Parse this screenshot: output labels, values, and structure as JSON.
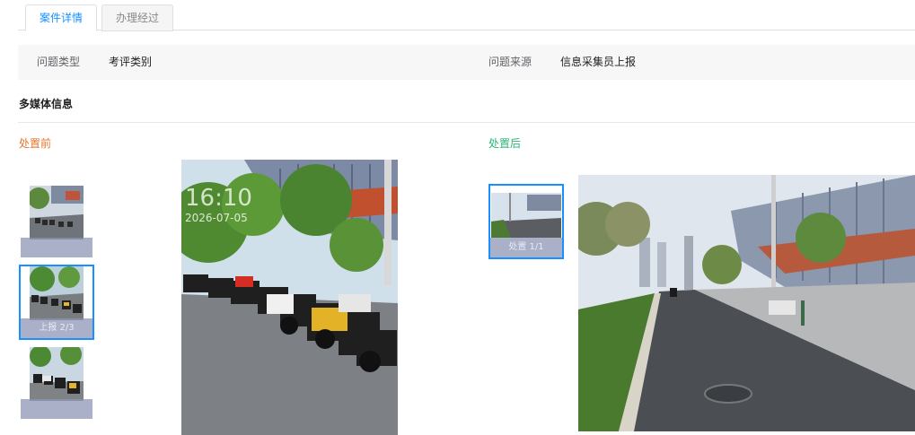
{
  "tabs": [
    {
      "label": "案件详情",
      "active": true
    },
    {
      "label": "办理经过",
      "active": false
    }
  ],
  "info": {
    "type_label": "问题类型",
    "type_value": "考评类别",
    "source_label": "问题来源",
    "source_value": "信息采集员上报"
  },
  "multimedia": {
    "title": "多媒体信息",
    "before_label": "处置前",
    "after_label": "处置后",
    "before_thumbs": [
      {
        "caption": ""
      },
      {
        "caption": "上报 2/3"
      },
      {
        "caption": ""
      }
    ],
    "after_thumbs": [
      {
        "caption": "处置 1/1"
      }
    ],
    "before_photo": {
      "time": "16:10",
      "date": "2026-07-05"
    }
  },
  "colors": {
    "accent": "#1890ff",
    "before": "#e6772e",
    "after": "#2bb673"
  }
}
